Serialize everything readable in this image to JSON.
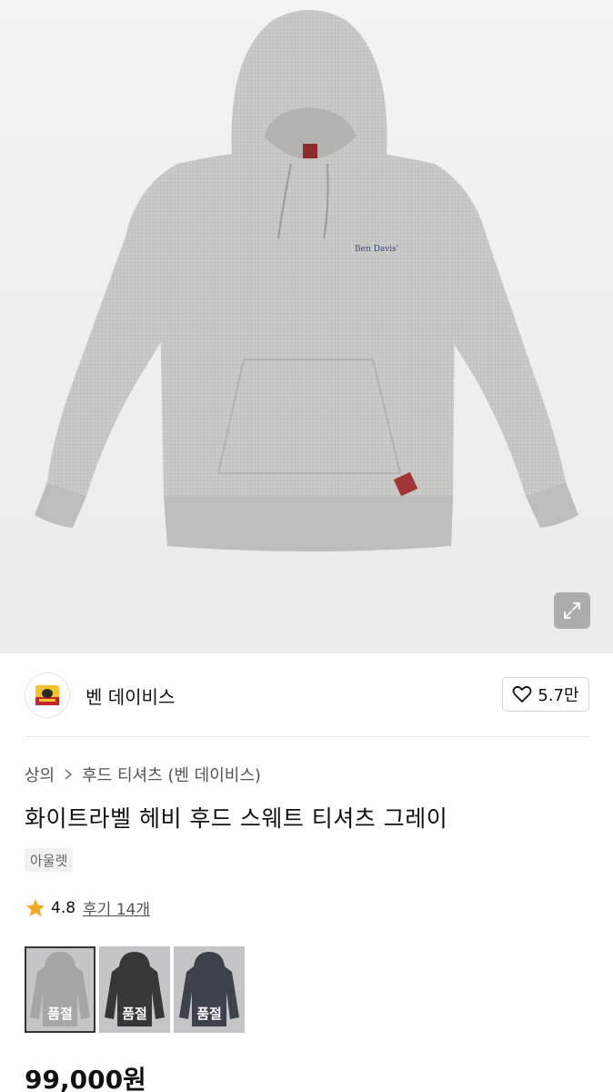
{
  "product": {
    "image_alt": "Ben Davis gray hoodie",
    "chest_logo_text": "Ben Davis",
    "expand_icon": "expand-icon"
  },
  "brand": {
    "name": "벤 데이비스",
    "logo_icon": "ben-davis-gorilla-logo",
    "likes": "5.7만",
    "like_icon": "heart-outline-icon"
  },
  "breadcrumb": {
    "items": [
      "상의",
      "후드 티셔츠 (벤 데이비스)"
    ],
    "separator_icon": "chevron-right-icon"
  },
  "title": "화이트라벨 헤비 후드 스웨트 티셔츠 그레이",
  "tag": "아울렛",
  "rating": {
    "score": "4.8",
    "reviews": "후기 14개",
    "star_color": "#f5a623"
  },
  "variants": [
    {
      "color": "gray",
      "label": "품절",
      "selected": true
    },
    {
      "color": "black",
      "label": "품절",
      "selected": false
    },
    {
      "color": "navy",
      "label": "품절",
      "selected": false
    }
  ],
  "price": "99,000원"
}
